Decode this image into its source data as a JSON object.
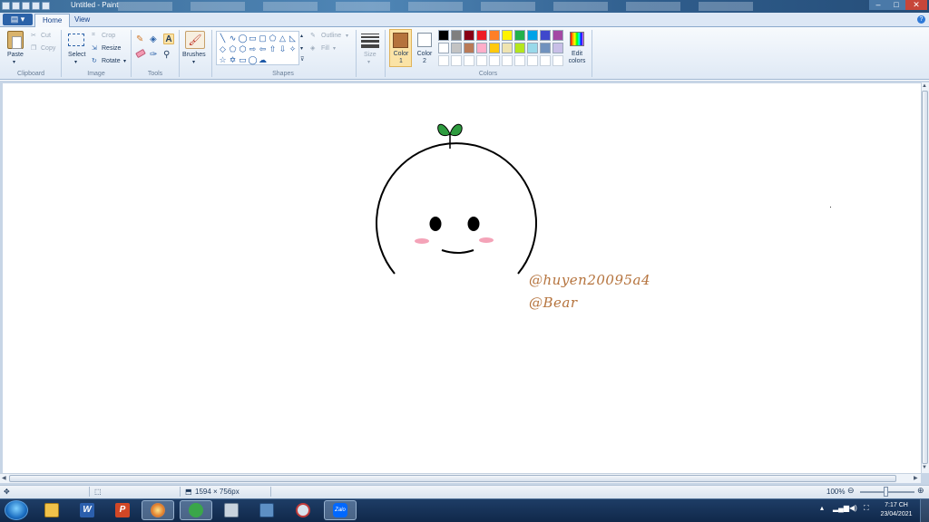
{
  "window": {
    "title": "Untitled - Paint"
  },
  "ribbon": {
    "tabs": [
      "Home",
      "View"
    ],
    "clipboard": {
      "paste": "Paste",
      "cut": "Cut",
      "copy": "Copy",
      "label": "Clipboard"
    },
    "image": {
      "select": "Select",
      "crop": "Crop",
      "resize": "Resize",
      "rotate": "Rotate",
      "label": "Image"
    },
    "tools": {
      "label": "Tools"
    },
    "brushes": {
      "label": "Brushes"
    },
    "shapes": {
      "outline": "Outline",
      "fill": "Fill",
      "label": "Shapes"
    },
    "size": {
      "label": "Size"
    },
    "colors": {
      "color1_label": "Color\n1",
      "color1_line1": "Color",
      "color1_line2": "1",
      "color2_line1": "Color",
      "color2_line2": "2",
      "edit_line1": "Edit",
      "edit_line2": "colors",
      "label": "Colors",
      "color1_value": "#b5733d",
      "color2_value": "#ffffff",
      "palette_row1": [
        "#000000",
        "#7f7f7f",
        "#880015",
        "#ed1c24",
        "#ff7f27",
        "#fff200",
        "#22b14c",
        "#00a2e8",
        "#3f48cc",
        "#a349a4"
      ],
      "palette_row2": [
        "#ffffff",
        "#c3c3c3",
        "#b97a57",
        "#ffaec9",
        "#ffc90e",
        "#efe4b0",
        "#b5e61d",
        "#99d9ea",
        "#7092be",
        "#c8bfe7"
      ],
      "palette_row3": [
        "#ffffff",
        "#ffffff",
        "#ffffff",
        "#ffffff",
        "#ffffff",
        "#ffffff",
        "#ffffff",
        "#ffffff",
        "#ffffff",
        "#ffffff"
      ]
    }
  },
  "canvas": {
    "text_line1": "@huyen20095a4",
    "text_line2": "@Bear"
  },
  "status": {
    "dimensions": "1594 × 756px",
    "zoom": "100%"
  },
  "taskbar": {
    "apps": [
      "explorer-icon",
      "word-icon",
      "powerpoint-icon",
      "paint-icon",
      "greenshot-icon",
      "calculator-icon",
      "network-icon",
      "snipping-icon",
      "zalo-icon"
    ],
    "zalo_label": "Zalo",
    "time": "7:17 CH",
    "date": "23/04/2021"
  }
}
